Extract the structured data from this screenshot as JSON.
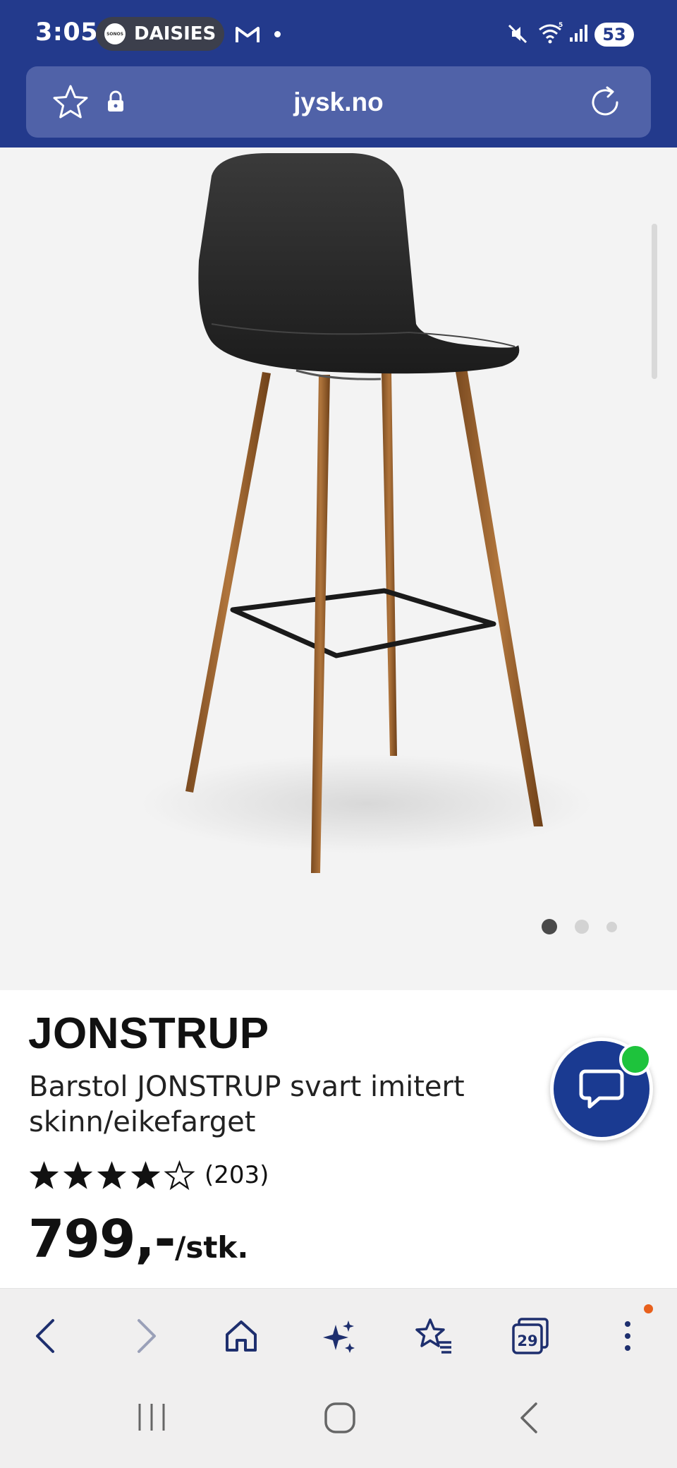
{
  "status_bar": {
    "time": "3:05",
    "sonos_logo": "SONOS",
    "media_title": "DAISIES",
    "battery": "53",
    "icons": [
      "sonos-icon",
      "gmail-icon",
      "notification-dot",
      "mute-icon",
      "wifi-icon",
      "signal-icon",
      "battery-icon"
    ]
  },
  "url_bar": {
    "url": "jysk.no",
    "icons": [
      "bookmark-star-icon",
      "lock-icon",
      "reload-icon"
    ]
  },
  "gallery": {
    "image": "black-leather-bar-stool-oak-legs",
    "slide_count": 3,
    "active_slide": 1
  },
  "product": {
    "title": "JONSTRUP",
    "description": "Barstol JONSTRUP svart imitert skinn/eikefarget",
    "rating": 4,
    "rating_max": 5,
    "review_count": "(203)",
    "price": "799,-",
    "price_unit": "/stk."
  },
  "chat": {
    "icon": "chat-bubble-icon",
    "badge_color": "#1ec33c"
  },
  "browser_nav": {
    "buttons": [
      "back-icon",
      "forward-icon",
      "home-icon",
      "ai-sparkle-icon",
      "bookmarks-icon",
      "tabs-icon",
      "more-menu-icon"
    ],
    "tab_count": "29"
  },
  "system_nav": {
    "buttons": [
      "recents-icon",
      "home-circle-icon",
      "system-back-icon"
    ]
  },
  "colors": {
    "brand_blue": "#233a8c",
    "url_bar": "#5062a8",
    "chat_blue": "#1a3a91",
    "chrome_gray": "#f0efef",
    "menu_dot": "#e8601c"
  }
}
